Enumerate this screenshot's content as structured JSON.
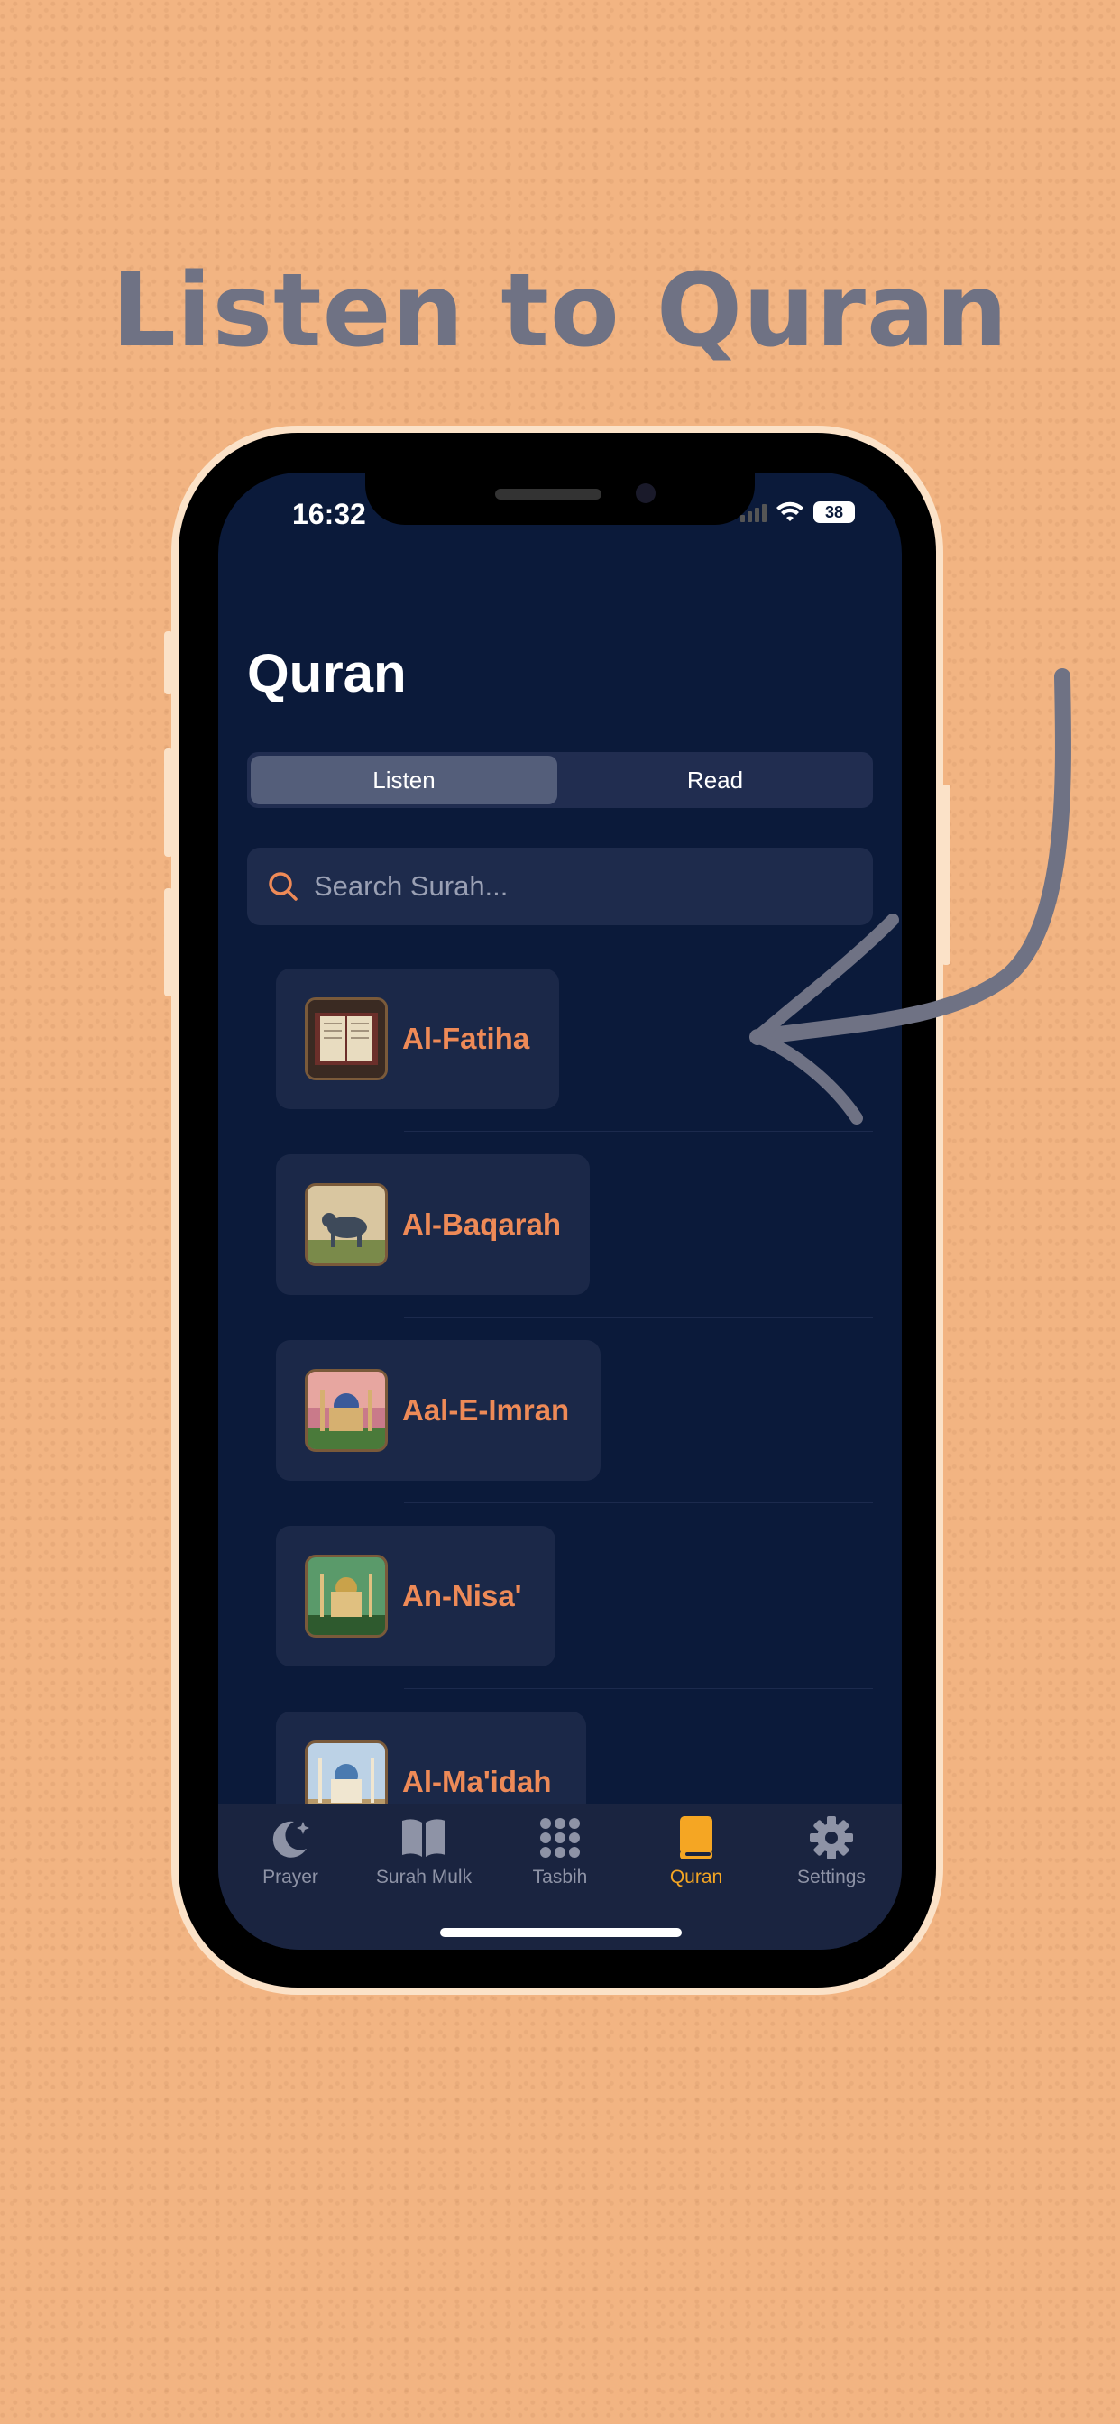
{
  "headline": "Listen to Quran",
  "status_bar": {
    "time": "16:32",
    "battery": "38"
  },
  "page": {
    "title": "Quran"
  },
  "segmented": {
    "listen": "Listen",
    "read": "Read"
  },
  "search": {
    "placeholder": "Search Surah..."
  },
  "surahs": [
    {
      "name": "Al-Fatiha"
    },
    {
      "name": "Al-Baqarah"
    },
    {
      "name": "Aal-E-Imran"
    },
    {
      "name": "An-Nisa'"
    },
    {
      "name": "Al-Ma'idah"
    }
  ],
  "tabbar": {
    "items": [
      {
        "label": "Prayer",
        "icon": "moon-stars-icon"
      },
      {
        "label": "Surah Mulk",
        "icon": "book-open-icon"
      },
      {
        "label": "Tasbih",
        "icon": "dots-grid-icon"
      },
      {
        "label": "Quran",
        "icon": "book-icon",
        "active": true
      },
      {
        "label": "Settings",
        "icon": "gear-icon"
      }
    ]
  },
  "colors": {
    "background": "#f2b482",
    "screen": "#0b1a3a",
    "accent_orange": "#ee8a57",
    "tab_active": "#f5a623",
    "headline": "#6f7284"
  }
}
